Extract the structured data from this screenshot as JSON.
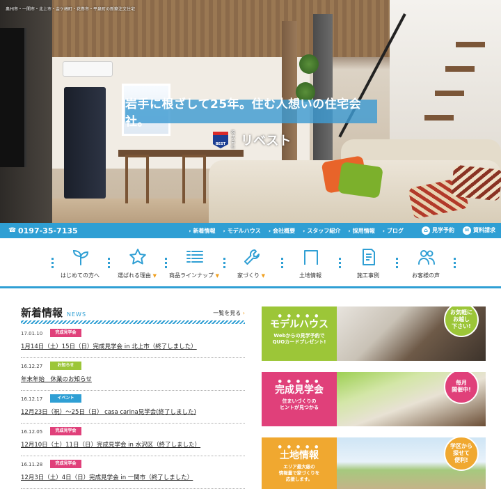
{
  "site": {
    "breadcrumb": "奥州市・一関市・北上市・金ケ崎町・花巻市・平泉町の新築注文住宅",
    "tagline": "岩手に根ざして25年。住む人想いの住宅会社。",
    "logo_badge": "BEST",
    "logo_kabushiki": "株式会社",
    "logo_name": "リベスト"
  },
  "topbar": {
    "phone": "0197-35-7135",
    "nav": [
      "新着情報",
      "モデルハウス",
      "会社概要",
      "スタッフ紹介",
      "採用情報",
      "ブログ"
    ],
    "reserve": "見学予約",
    "request": "資料請求"
  },
  "iconnav": [
    {
      "label": "はじめての方へ",
      "icon": "sprout-icon",
      "arrow": ""
    },
    {
      "label": "選ばれる理由",
      "icon": "star-icon",
      "arrow": "▼"
    },
    {
      "label": "商品ラインナップ",
      "icon": "list-icon",
      "arrow": "▼"
    },
    {
      "label": "家づくり",
      "icon": "wrench-icon",
      "arrow": "▼"
    },
    {
      "label": "土地情報",
      "icon": "land-icon",
      "arrow": ""
    },
    {
      "label": "施工事例",
      "icon": "document-icon",
      "arrow": ""
    },
    {
      "label": "お客様の声",
      "icon": "people-icon",
      "arrow": ""
    }
  ],
  "news": {
    "title": "新着情報",
    "subtitle": "NEWS",
    "more": "一覧を見る",
    "items": [
      {
        "date": "17.01.10",
        "tag": "完成見学会",
        "tag_color": "#e0407a",
        "text": "1月14日（土）15日（日）完成見学会 in 北上市（終了しました）"
      },
      {
        "date": "16.12.27",
        "tag": "お知らせ",
        "tag_color": "#9cc638",
        "text": "年末年始　休業のお知らせ"
      },
      {
        "date": "16.12.17",
        "tag": "イベント",
        "tag_color": "#2f9fd4",
        "text": "12月23日（祝）〜25日（日） casa carina見学会(終了しました)"
      },
      {
        "date": "16.12.05",
        "tag": "完成見学会",
        "tag_color": "#e0407a",
        "text": "12月10日（土）11日（日）完成見学会 in 水沢区（終了しました）"
      },
      {
        "date": "16.11.28",
        "tag": "完成見学会",
        "tag_color": "#e0407a",
        "text": "12月3日（土）4日（日）完成見学会 in 一関市（終了しました）"
      }
    ]
  },
  "banners": [
    {
      "title": "モデルハウス",
      "sub": "Webからの見学予約で\nQUOカードプレゼント!",
      "color": "#9cc638",
      "circle": "お気軽に\nお越し\n下さい!",
      "circle_color": "#9cc638"
    },
    {
      "title": "完成見学会",
      "sub": "住まいづくりの\nヒントが見つかる",
      "color": "#e0407a",
      "circle": "毎月\n開催中!",
      "circle_color": "#e0407a"
    },
    {
      "title": "土地情報",
      "sub": "エリア最大級の\n情報量で家づくりを\n応援します。",
      "color": "#f0a830",
      "circle": "学区から\n探せて\n便利!",
      "circle_color": "#f0a830"
    }
  ]
}
